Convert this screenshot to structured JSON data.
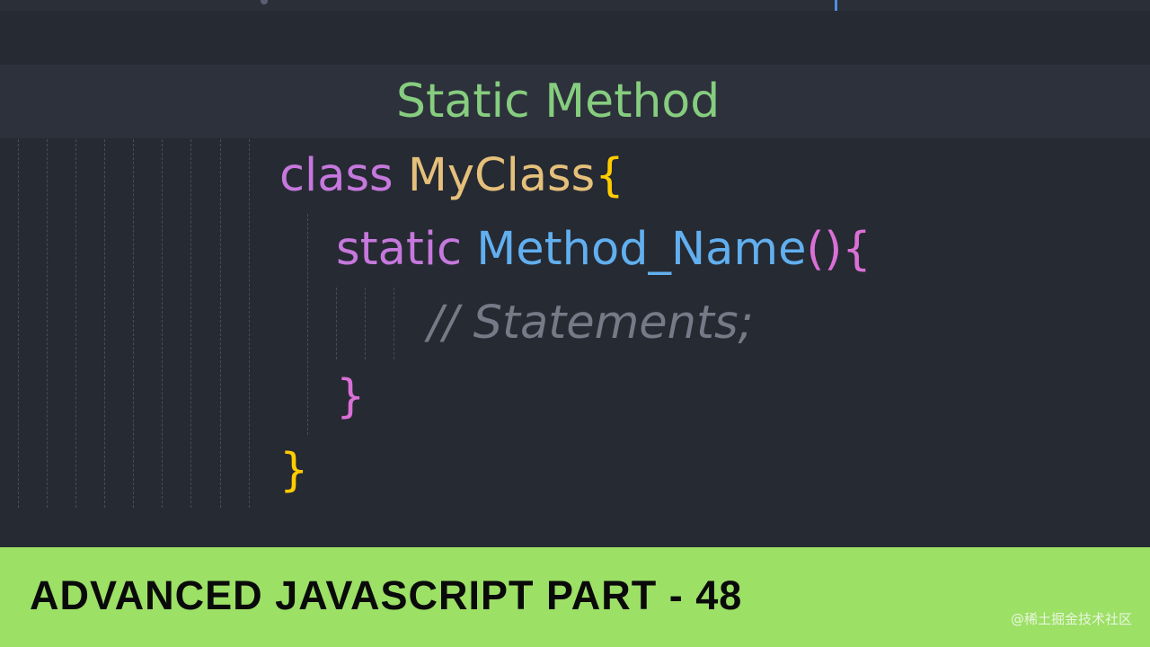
{
  "title": "Static Method",
  "code": {
    "line1": {
      "keyword": "class",
      "class_name": "MyClass",
      "open_brace": "{"
    },
    "line2": {
      "keyword": "static",
      "method_name": "Method_Name",
      "parens": "()",
      "open_brace": "{"
    },
    "line3": {
      "comment": "// Statements;"
    },
    "line4": {
      "close_brace": "}"
    },
    "line5": {
      "close_brace": "}"
    }
  },
  "banner": {
    "text": "ADVANCED JAVASCRIPT PART - 48",
    "watermark": "@稀土掘金技术社区"
  },
  "colors": {
    "background": "#262a33",
    "title": "#86cd7f",
    "keyword": "#c678dd",
    "class_name": "#e5c07b",
    "method_name": "#61afef",
    "comment": "#757a86",
    "banner": "#9ce066"
  }
}
